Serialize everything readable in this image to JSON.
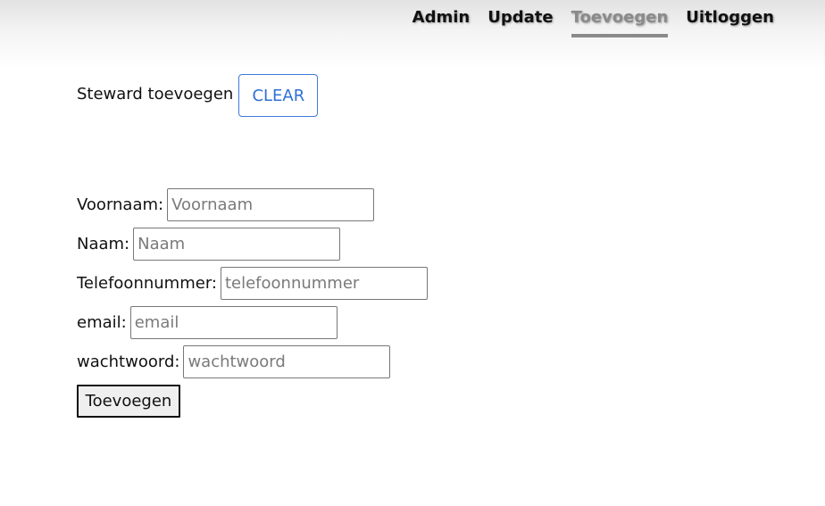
{
  "nav": {
    "items": [
      {
        "label": "Admin",
        "active": false
      },
      {
        "label": "Update",
        "active": false
      },
      {
        "label": "Toevoegen",
        "active": true
      },
      {
        "label": "Uitloggen",
        "active": false
      }
    ]
  },
  "header": {
    "title": "Steward toevoegen",
    "clear_label": "CLEAR"
  },
  "form": {
    "fields": [
      {
        "label": "Voornaam:",
        "placeholder": "Voornaam",
        "value": ""
      },
      {
        "label": "Naam:",
        "placeholder": "Naam",
        "value": ""
      },
      {
        "label": "Telefoonnummer:",
        "placeholder": "telefoonnummer",
        "value": ""
      },
      {
        "label": "email:",
        "placeholder": "email",
        "value": ""
      },
      {
        "label": "wachtwoord:",
        "placeholder": "wachtwoord",
        "value": ""
      }
    ],
    "submit_label": "Toevoegen"
  },
  "colors": {
    "active_nav": "#8a8a8a",
    "clear_button": "#2f6fd6"
  }
}
